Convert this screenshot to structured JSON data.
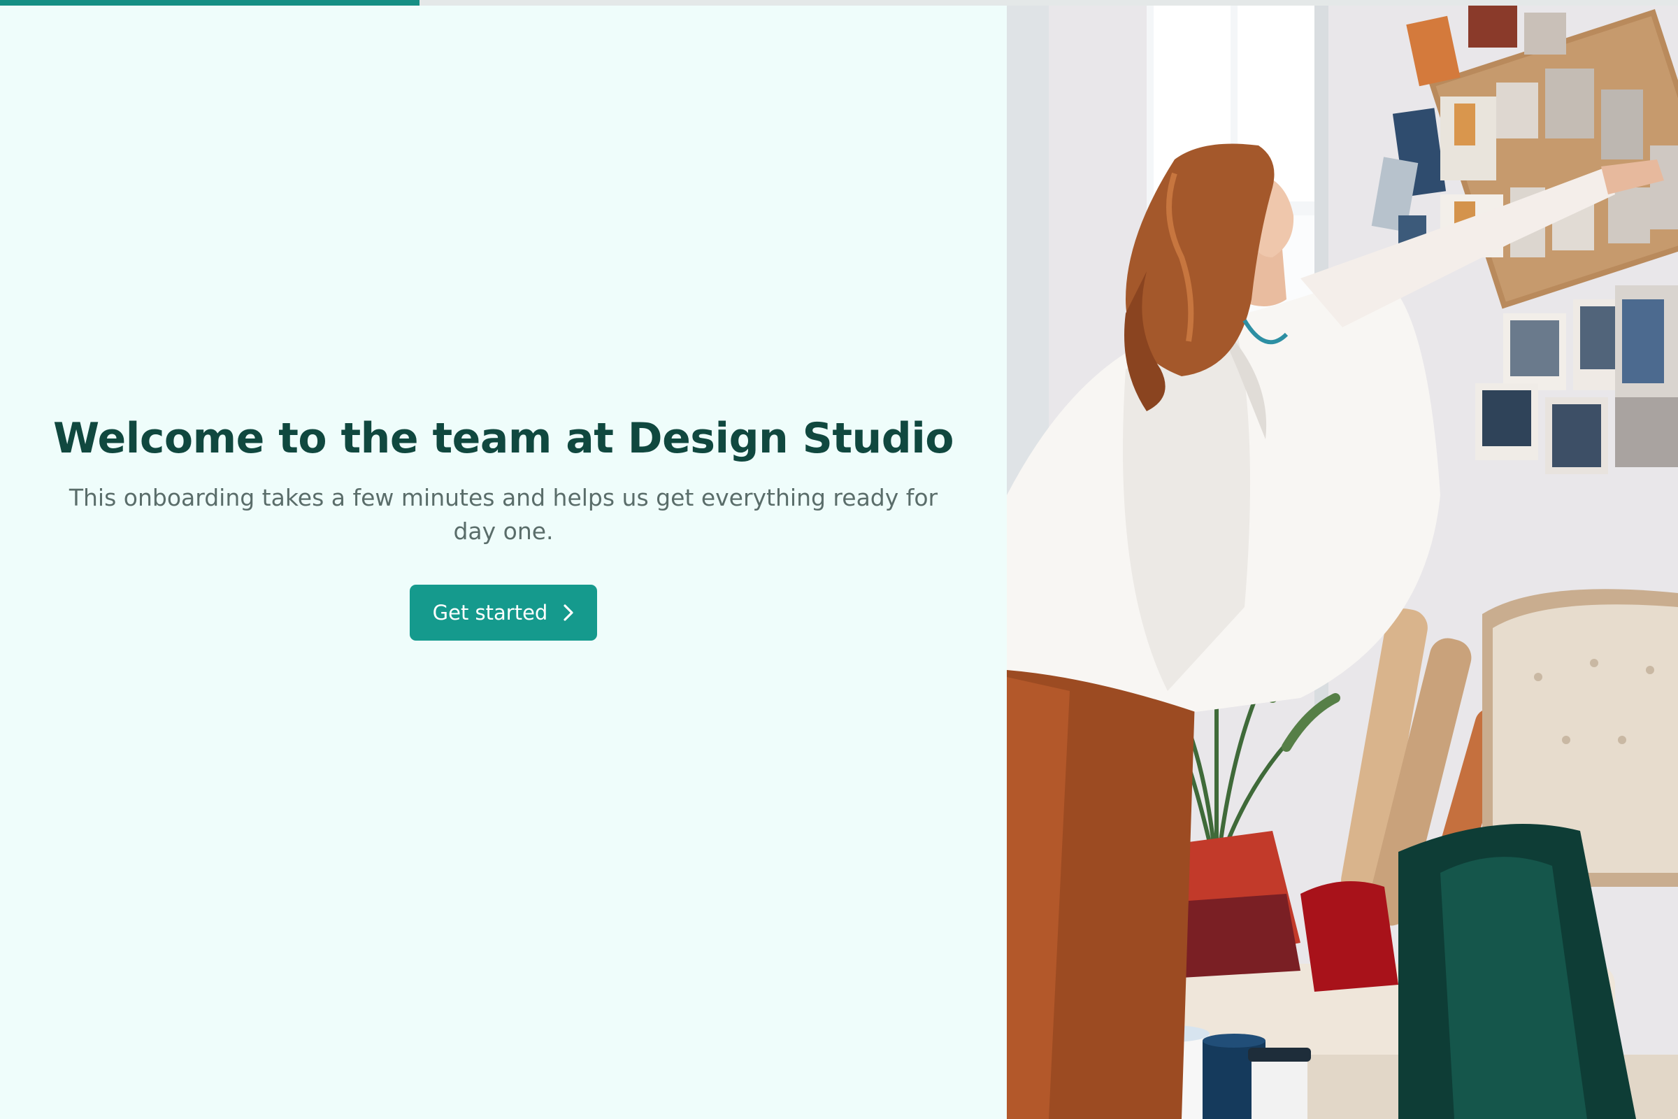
{
  "progress": {
    "value_percent": 25,
    "fill_color": "#158f84",
    "track_color": "#e4e8e8"
  },
  "welcome": {
    "title": "Welcome to the team at Design Studio",
    "subtitle": "This onboarding takes a few minutes and helps us get everything ready for day one.",
    "cta_label": "Get started",
    "cta_icon": "chevron-right-icon"
  },
  "hero_image": {
    "description_icon": "photo"
  },
  "colors": {
    "background": "#effdfb",
    "title": "#10483f",
    "accent": "#159a8d"
  }
}
